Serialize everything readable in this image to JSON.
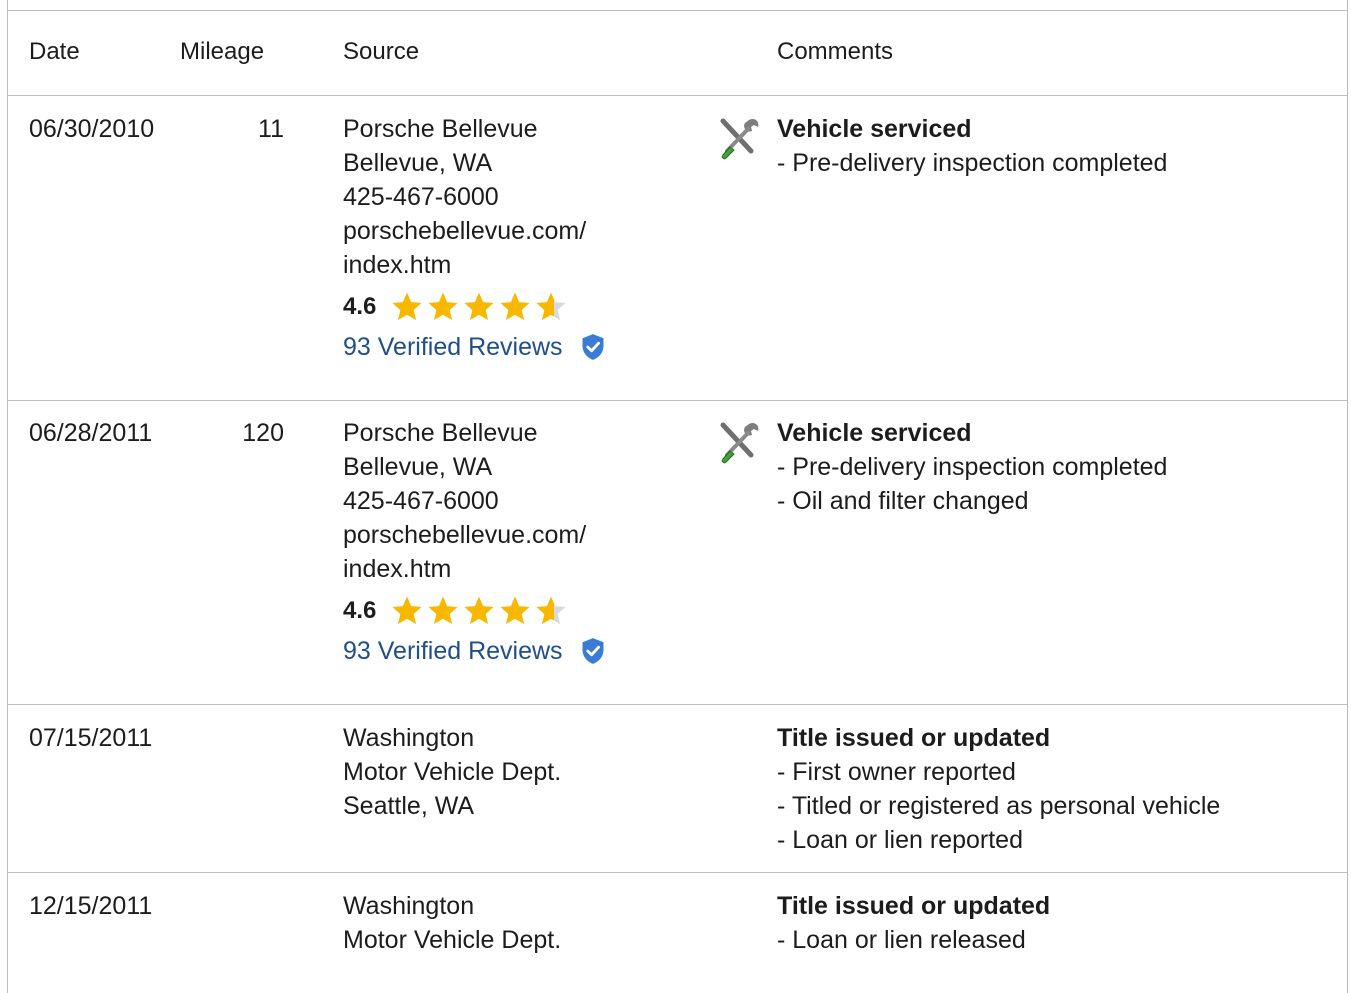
{
  "table": {
    "headers": {
      "date": "Date",
      "mileage": "Mileage",
      "source": "Source",
      "comments": "Comments"
    },
    "rows": [
      {
        "date": "06/30/2010",
        "mileage": "11",
        "source": [
          "Porsche Bellevue",
          "Bellevue, WA",
          "425-467-6000",
          "porschebellevue.com/",
          "index.htm"
        ],
        "rating": {
          "value": "4.6",
          "stars": 4.6
        },
        "reviews": "93 Verified Reviews",
        "icon": "wrench-screwdriver-icon",
        "title": "Vehicle serviced",
        "comments": [
          "- Pre-delivery inspection completed"
        ]
      },
      {
        "date": "06/28/2011",
        "mileage": "120",
        "source": [
          "Porsche Bellevue",
          "Bellevue, WA",
          "425-467-6000",
          "porschebellevue.com/",
          "index.htm"
        ],
        "rating": {
          "value": "4.6",
          "stars": 4.6
        },
        "reviews": "93 Verified Reviews",
        "icon": "wrench-screwdriver-icon",
        "title": "Vehicle serviced",
        "comments": [
          "- Pre-delivery inspection completed",
          "- Oil and filter changed"
        ]
      },
      {
        "date": "07/15/2011",
        "mileage": "",
        "source": [
          "Washington",
          "Motor Vehicle Dept.",
          "Seattle, WA"
        ],
        "title": "Title issued or updated",
        "comments": [
          "- First owner reported",
          "- Titled or registered as personal vehicle",
          "- Loan or lien reported"
        ]
      },
      {
        "date": "12/15/2011",
        "mileage": "",
        "source": [
          "Washington",
          "Motor Vehicle Dept."
        ],
        "title": "Title issued or updated",
        "comments": [
          "- Loan or lien released"
        ]
      }
    ]
  },
  "colors": {
    "star": "#f8b800",
    "star_empty": "#d9d9d9",
    "link": "#1f4e8c",
    "shield": "#3a7bd5",
    "border": "#bdbdbd"
  }
}
